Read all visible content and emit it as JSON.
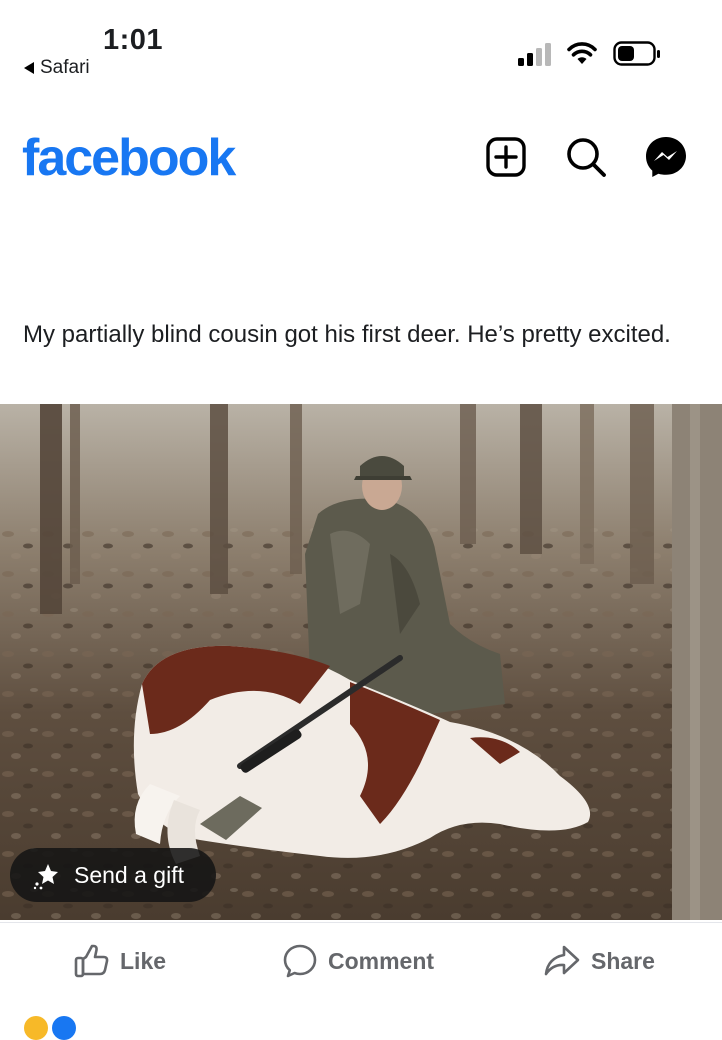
{
  "status_bar": {
    "time": "1:01",
    "back_app": "Safari",
    "signal_bars": 2,
    "wifi": "wifi-icon",
    "battery": "battery-icon"
  },
  "header": {
    "logo_text": "facebook",
    "brand_color": "#1877f2",
    "buttons": [
      {
        "icon": "create-post-icon"
      },
      {
        "icon": "search-icon"
      },
      {
        "icon": "messenger-icon"
      }
    ]
  },
  "post": {
    "caption": "My partially blind cousin got his first deer. He’s pretty excited.",
    "photo": {
      "icon": "post-photo"
    },
    "gift_button": {
      "label": "Send a gift",
      "icon": "gift-sparkle-icon"
    },
    "actions": {
      "like": "Like",
      "comment": "Comment",
      "share": "Share"
    }
  }
}
